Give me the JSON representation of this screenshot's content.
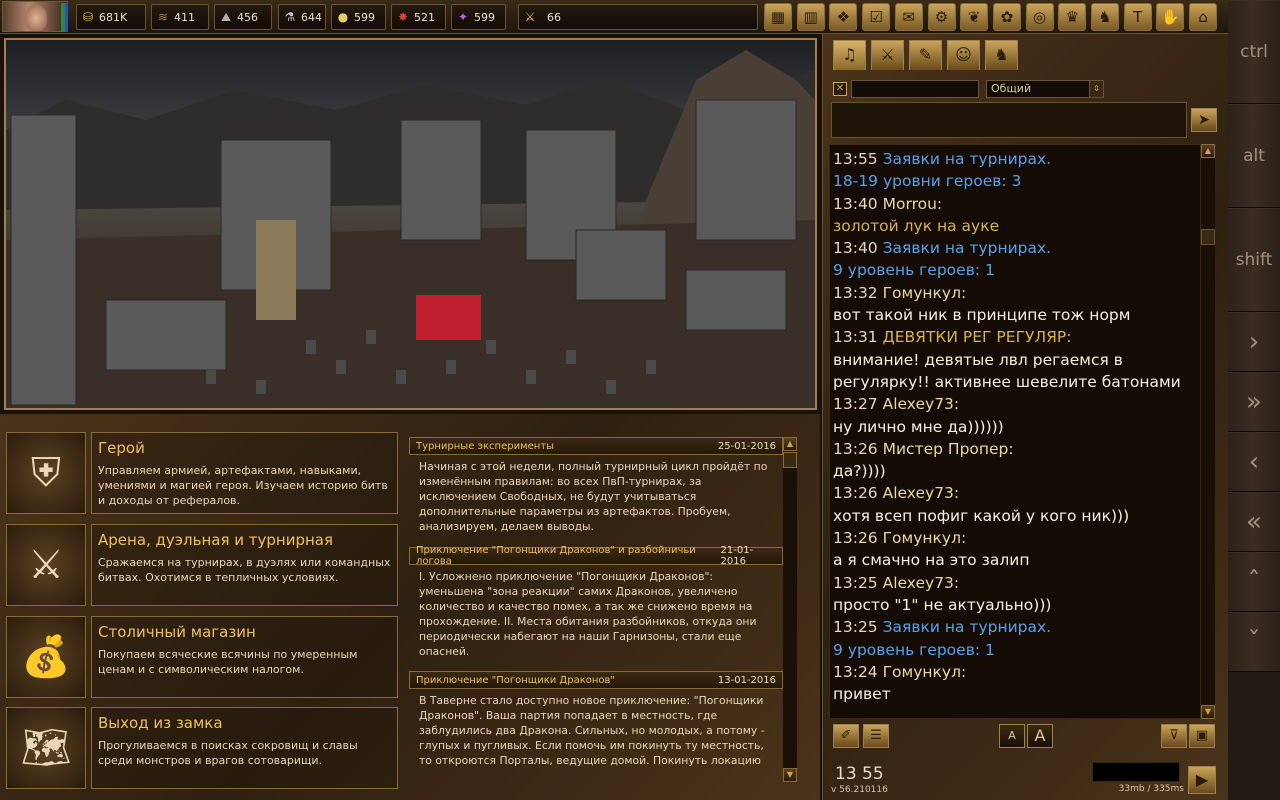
{
  "top_bar": {
    "resources": [
      {
        "icon": "gold-icon",
        "glyph": "⛁",
        "value": "681K",
        "color": "#e8c040"
      },
      {
        "icon": "wood-icon",
        "glyph": "≋",
        "value": "411",
        "color": "#a88050"
      },
      {
        "icon": "ore-icon",
        "glyph": "⛰",
        "value": "456",
        "color": "#b0b0b0"
      },
      {
        "icon": "mercury-icon",
        "glyph": "⚗",
        "value": "644",
        "color": "#c8c8c8"
      },
      {
        "icon": "sulfur-icon",
        "glyph": "●",
        "value": "599",
        "color": "#e8d060"
      },
      {
        "icon": "crystal-icon",
        "glyph": "✸",
        "value": "521",
        "color": "#e04040"
      },
      {
        "icon": "gems-icon",
        "glyph": "✦",
        "value": "599",
        "color": "#c060e0"
      }
    ],
    "army": {
      "icon": "army-icon",
      "glyph": "⚔",
      "value": "66"
    },
    "menu": [
      {
        "name": "castle-menu-icon",
        "glyph": "▦"
      },
      {
        "name": "journal-menu-icon",
        "glyph": "▥"
      },
      {
        "name": "quest-menu-icon",
        "glyph": "❖"
      },
      {
        "name": "checklist-menu-icon",
        "glyph": "☑"
      },
      {
        "name": "mail-menu-icon",
        "glyph": "✉"
      },
      {
        "name": "settings-menu-icon",
        "glyph": "⚙"
      },
      {
        "name": "laurel-menu-icon",
        "glyph": "❦"
      },
      {
        "name": "lotus-menu-icon",
        "glyph": "✿"
      },
      {
        "name": "map-menu-icon",
        "glyph": "◎"
      },
      {
        "name": "crown-menu-icon",
        "glyph": "♛"
      },
      {
        "name": "horse-menu-icon",
        "glyph": "♞"
      },
      {
        "name": "torch-menu-icon",
        "glyph": "T"
      },
      {
        "name": "hand-menu-icon",
        "glyph": "✋"
      },
      {
        "name": "gate-menu-icon",
        "glyph": "⌂"
      }
    ]
  },
  "keys": [
    {
      "name": "ctrl-key",
      "label": "ctrl"
    },
    {
      "name": "alt-key",
      "label": "alt"
    },
    {
      "name": "shift-key",
      "label": "shift"
    },
    {
      "name": "right-key",
      "label": "›"
    },
    {
      "name": "fast-right-key",
      "label": "»"
    },
    {
      "name": "left-key",
      "label": "‹"
    },
    {
      "name": "fast-left-key",
      "label": "«"
    },
    {
      "name": "up-key",
      "label": "ˆ"
    },
    {
      "name": "down-key",
      "label": "ˇ"
    }
  ],
  "cards": [
    {
      "name": "hero",
      "icon": "armor-icon",
      "glyph": "⛨",
      "title": "Герой",
      "desc": "Управляем армией, артефактами, навыками, умениями и магией героя. Изучаем историю битв и доходы от рефералов."
    },
    {
      "name": "arena",
      "icon": "swords-icon",
      "glyph": "⚔",
      "title": "Арена, дуэльная и турнирная",
      "desc": "Сражаемся на турнирах, в дуэлях или командных битвах. Охотимся в тепличных условиях."
    },
    {
      "name": "shop",
      "icon": "treasure-bag-icon",
      "glyph": "💰",
      "title": "Столичный магазин",
      "desc": "Покупаем всяческие всячины по умеренным ценам и с символическим налогом."
    },
    {
      "name": "exit",
      "icon": "treasure-map-icon",
      "glyph": "🗺",
      "title": "Выход из замка",
      "desc": "Прогуливаемся в поисках сокровищ и славы среди монстров и врагов сотоварищи."
    }
  ],
  "news": [
    {
      "title": "Турнирные эксперименты",
      "date": "25-01-2016",
      "body": "Начиная с этой недели, полный турнирный цикл пройдёт по изменённым правилам: во всех ПвП-турнирах, за исключением Свободных, не будут учитываться дополнительные параметры из артефактов. Пробуем, анализируем, делаем выводы."
    },
    {
      "title": "Приключение \"Погонщики Драконов\" и разбойничьи логова",
      "date": "21-01-2016",
      "body": "I. Усложнено приключение \"Погонщики Драконов\": уменьшена \"зона реакции\" самих Драконов, увеличено количество и качество помех, а так же снижено время на прохождение. II. Места обитания разбойников, откуда они периодически набегают на наши Гарнизоны, стали еще опасней."
    },
    {
      "title": "Приключение \"Погонщики Драконов\"",
      "date": "13-01-2016",
      "body": "В Таверне стало доступно новое приключение: \"Погонщики Драконов\". Ваша партия попадает в местность, где заблудились два Дракона. Сильных, но молодых, а потому - глупых и пугливых. Если помочь им покинуть ту местность, то откроются Порталы, ведущие домой. Покинуть локацию"
    }
  ],
  "chat": {
    "tabs": [
      {
        "name": "tab-horn",
        "glyph": "♫"
      },
      {
        "name": "tab-battle",
        "glyph": "⚔"
      },
      {
        "name": "tab-book",
        "glyph": "✎"
      },
      {
        "name": "tab-masks",
        "glyph": "☺"
      },
      {
        "name": "tab-horse",
        "glyph": "♞"
      }
    ],
    "channel": "Общий",
    "messages": [
      {
        "time": "13:55",
        "name": "Заявки на турнирах.",
        "type": "sys"
      },
      {
        "text": "18-19 уровни героев: 3",
        "type": "sys"
      },
      {
        "time": "13:40",
        "name": "Morrou:",
        "type": "user"
      },
      {
        "text": "золотой лук на ауке",
        "type": "gold"
      },
      {
        "time": "13:40",
        "name": "Заявки на турнирах.",
        "type": "sys"
      },
      {
        "text": "9 уровень героев: 1",
        "type": "sys"
      },
      {
        "time": "13:32",
        "name": "Гомункул:",
        "type": "user"
      },
      {
        "text": "вот такой ник в принципе тож норм",
        "type": "user"
      },
      {
        "time": "13:31",
        "name": "ДЕВЯТКИ РЕГ РЕГУЛЯР:",
        "type": "gold"
      },
      {
        "text": "внимание! девятые лвл регаемся в",
        "type": "user"
      },
      {
        "text": "регулярку!! активнее шевелите батонами",
        "type": "user"
      },
      {
        "time": "13:27",
        "name": "Alexey73:",
        "type": "user"
      },
      {
        "text": "ну лично мне да))))))",
        "type": "user"
      },
      {
        "time": "13:26",
        "name": "Мистер Пропер:",
        "type": "user"
      },
      {
        "text": "да?))))",
        "type": "user"
      },
      {
        "time": "13:26",
        "name": "Alexey73:",
        "type": "user"
      },
      {
        "text": "хотя всеп пофиг какой у кого ник)))",
        "type": "user"
      },
      {
        "time": "13:26",
        "name": "Гомункул:",
        "type": "user"
      },
      {
        "text": "а я смачно на это залип",
        "type": "user"
      },
      {
        "time": "13:25",
        "name": "Alexey73:",
        "type": "user"
      },
      {
        "text": "просто \"1\" не актуально)))",
        "type": "user"
      },
      {
        "time": "13:25",
        "name": "Заявки на турнирах.",
        "type": "sys"
      },
      {
        "text": "9 уровень героев: 1",
        "type": "sys"
      },
      {
        "time": "13:24",
        "name": "Гомункул:",
        "type": "user"
      },
      {
        "text": "привет",
        "type": "user"
      }
    ],
    "clock": "13 55",
    "version": "v 56.210116",
    "memory": "33mb / 335ms",
    "font_small": "A",
    "font_large": "A"
  }
}
